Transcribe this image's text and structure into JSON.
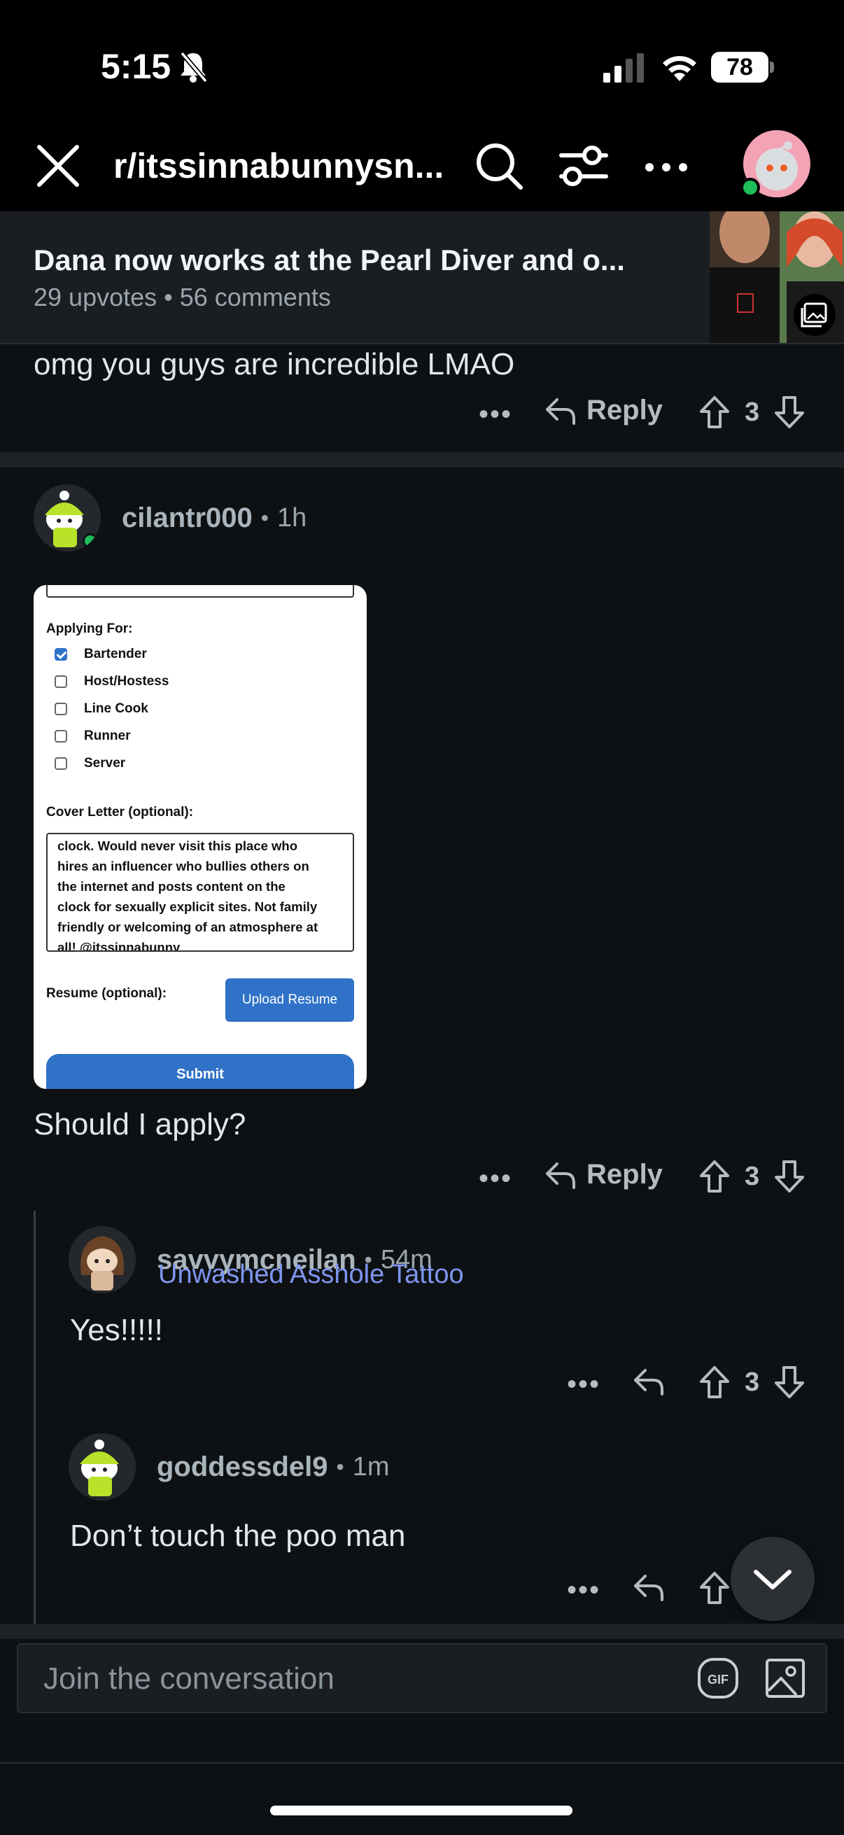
{
  "status_bar": {
    "time": "5:15",
    "battery": "78"
  },
  "header": {
    "subreddit": "r/itssinnabunnysn..."
  },
  "post": {
    "title": "Dana now works at the Pearl Diver and o...",
    "upvotes": "29 upvotes",
    "comments": "56 comments"
  },
  "prev_comment": {
    "text": "omg you guys are incredible LMAO",
    "reply_label": "Reply",
    "votes": "3"
  },
  "comment": {
    "user": "cilantr000",
    "time": "1h",
    "text": "Should I apply?",
    "reply_label": "Reply",
    "votes": "3",
    "image": {
      "applying_label": "Applying For:",
      "options": [
        {
          "label": "Bartender",
          "checked": true
        },
        {
          "label": "Host/Hostess",
          "checked": false
        },
        {
          "label": "Line Cook",
          "checked": false
        },
        {
          "label": "Runner",
          "checked": false
        },
        {
          "label": "Server",
          "checked": false
        }
      ],
      "cover_label": "Cover Letter (optional):",
      "cover_lines": [
        "clock. Would never visit this place who",
        "hires an influencer who bullies others on",
        "the internet and posts content on the",
        "clock for sexually explicit sites. Not family",
        "friendly or welcoming of an atmosphere at",
        "all! @itssinnabunny"
      ],
      "resume_label": "Resume (optional):",
      "upload_button": "Upload Resume",
      "submit_button": "Submit"
    }
  },
  "replies": [
    {
      "user": "savvymcneilan",
      "time": "54m",
      "flair": "Unwashed Asshole Tattoo",
      "text": "Yes!!!!!",
      "votes": "3"
    },
    {
      "user": "goddessdel9",
      "time": "1m",
      "text": "Don’t touch the poo man"
    }
  ],
  "composer": {
    "placeholder": "Join the conversation",
    "gif_label": "GIF"
  },
  "colors": {
    "background": "#0e1113",
    "accent_blue": "#2f72c8",
    "flair": "#7f95f0",
    "online": "#1fbd59"
  }
}
